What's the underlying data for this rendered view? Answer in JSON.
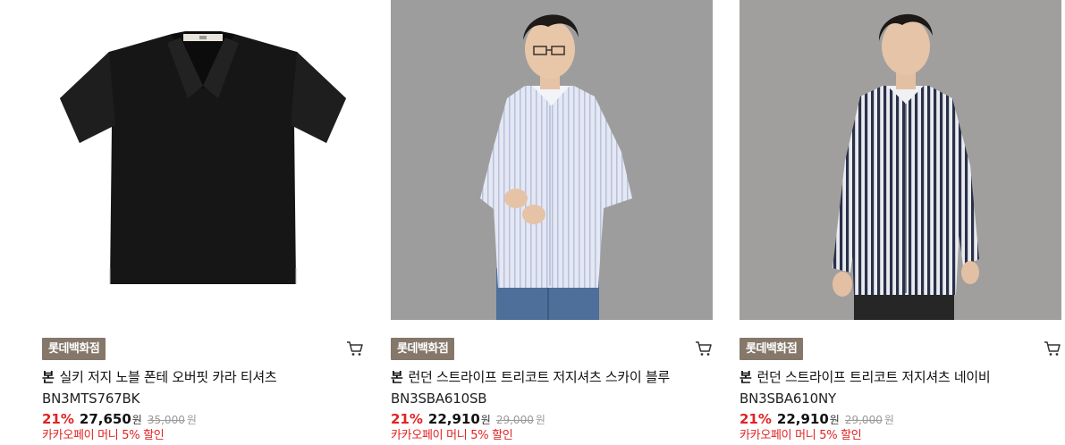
{
  "products": [
    {
      "store": "롯데백화점",
      "brand": "본",
      "name": "실키 저지 노블 폰테 오버핏 카라 티셔츠",
      "code": "BN3MTS767BK",
      "discount": "21%",
      "price": "27,650",
      "price_unit": "원",
      "original_price": "35,000",
      "original_unit": "원",
      "promo": "카카오페이 머니 5% 할인",
      "image_icon": "black-polo-shirt-image",
      "cart_icon": "cart-icon"
    },
    {
      "store": "롯데백화점",
      "brand": "본",
      "name": "런던 스트라이프 트리코트 저지셔츠 스카이 블루",
      "code": "BN3SBA610SB",
      "discount": "21%",
      "price": "22,910",
      "price_unit": "원",
      "original_price": "29,000",
      "original_unit": "원",
      "promo": "카카오페이 머니 5% 할인",
      "image_icon": "model-sky-blue-shirt-image",
      "cart_icon": "cart-icon"
    },
    {
      "store": "롯데백화점",
      "brand": "본",
      "name": "런던 스트라이프 트리코트 저지셔츠 네이비",
      "code": "BN3SBA610NY",
      "discount": "21%",
      "price": "22,910",
      "price_unit": "원",
      "original_price": "29,000",
      "original_unit": "원",
      "promo": "카카오페이 머니 5% 할인",
      "image_icon": "model-navy-stripe-shirt-image",
      "cart_icon": "cart-icon"
    }
  ],
  "colors": {
    "badge": "#85786a",
    "discount": "#e22222",
    "promo": "#e22222",
    "original_price": "#999999"
  }
}
